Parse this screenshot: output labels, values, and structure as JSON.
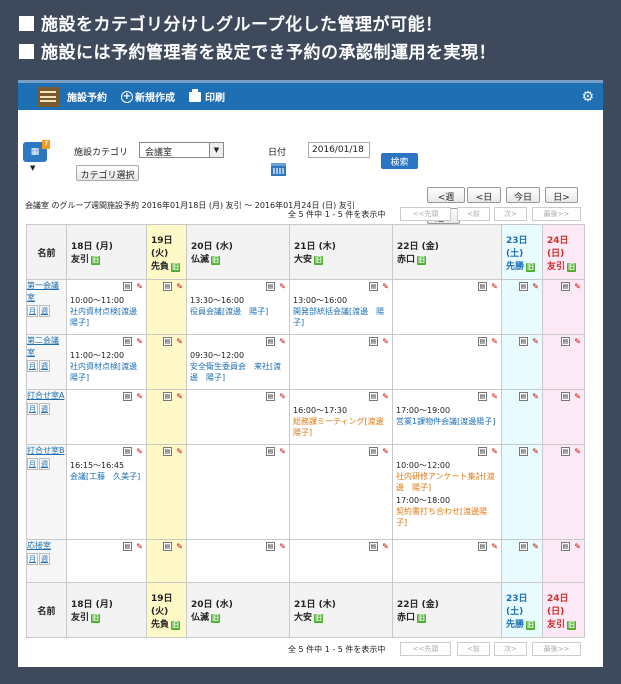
{
  "headings": [
    "施設をカテゴリ分けしグループ化した管理が可能！",
    "施設には予約管理者を設定でき予約の承認制運用を実現！"
  ],
  "topbar": {
    "title": "施設予約",
    "new_label": "新規作成",
    "print_label": "印刷"
  },
  "form": {
    "category_label": "施設カテゴリ",
    "category_value": "会議室",
    "category_button": "カテゴリ選択",
    "date_label": "日付",
    "date_value": "2016/01/18",
    "search_label": "検索"
  },
  "range_text": "会議室 のグループ週間施設予約  2016年01月18日 (月) 友引 ～ 2016年01月24日 (日) 友引",
  "nav": {
    "prev_week": "<週",
    "prev_day": "<日",
    "today": "今日",
    "next_day": "日>",
    "next_week": "週>"
  },
  "pager": {
    "count": "全 5 件中 1 - 5 件を表示中",
    "first": "<<先頭",
    "prev": "<前",
    "next": "次>",
    "last": "最後>>"
  },
  "table": {
    "name_header": "名前",
    "days": [
      {
        "date": "18日 (月)",
        "rokuyo": "友引",
        "cls": ""
      },
      {
        "date": "19日 (火)",
        "rokuyo": "先負",
        "cls": "col-tue"
      },
      {
        "date": "20日 (水)",
        "rokuyo": "仏滅",
        "cls": ""
      },
      {
        "date": "21日 (木)",
        "rokuyo": "大安",
        "cls": ""
      },
      {
        "date": "22日 (金)",
        "rokuyo": "赤口",
        "cls": ""
      },
      {
        "date": "23日 (土)",
        "rokuyo": "先勝",
        "cls": "col-sat"
      },
      {
        "date": "24日 (日)",
        "rokuyo": "友引",
        "cls": "col-sun"
      }
    ],
    "badge": "旧",
    "room_links": [
      "月",
      "週"
    ],
    "rooms": [
      {
        "name": "第一会議室",
        "events": [
          [
            {
              "time": "10:00～11:00",
              "desc": "社内資材点検[渡邊　陽子]",
              "color": "blue"
            }
          ],
          [],
          [
            {
              "time": "13:30～16:00",
              "desc": "役員会議[渡邊　陽子]",
              "color": "blue"
            }
          ],
          [
            {
              "time": "13:00～16:00",
              "desc": "開発部統括会議[渡邊　陽子]",
              "color": "blue"
            }
          ],
          [],
          [],
          []
        ]
      },
      {
        "name": "第二会議室",
        "events": [
          [
            {
              "time": "11:00～12:00",
              "desc": "社内資材点検[渡邊　陽子]",
              "color": "blue"
            }
          ],
          [],
          [
            {
              "time": "09:30～12:00",
              "desc": "安全衛生委員会　来社[渡邊　陽子]",
              "color": "blue"
            }
          ],
          [],
          [],
          [],
          []
        ]
      },
      {
        "name": "打合せ室A",
        "events": [
          [],
          [],
          [],
          [
            {
              "time": "16:00～17:30",
              "desc": "総務課ミーティング[渡邊　陽子]",
              "color": "orange"
            }
          ],
          [
            {
              "time": "17:00～19:00",
              "desc": "営業1課物件会議[渡邊陽子]",
              "color": "blue"
            }
          ],
          [],
          []
        ]
      },
      {
        "name": "打合せ室B",
        "events": [
          [
            {
              "time": "16:15～16:45",
              "desc": "会議[工藤　久美子]",
              "color": "blue"
            }
          ],
          [],
          [],
          [],
          [
            {
              "time": "10:00～12:00",
              "desc": "社内研修アンケート集計[渡邊　陽子]",
              "color": "orange"
            },
            {
              "time": "17:00～18:00",
              "desc": "契約書打ち合わせ[渡邊陽子]",
              "color": "orange"
            }
          ],
          [],
          []
        ]
      },
      {
        "name": "応接室",
        "events": [
          [],
          [],
          [],
          [],
          [],
          [],
          []
        ]
      }
    ]
  }
}
